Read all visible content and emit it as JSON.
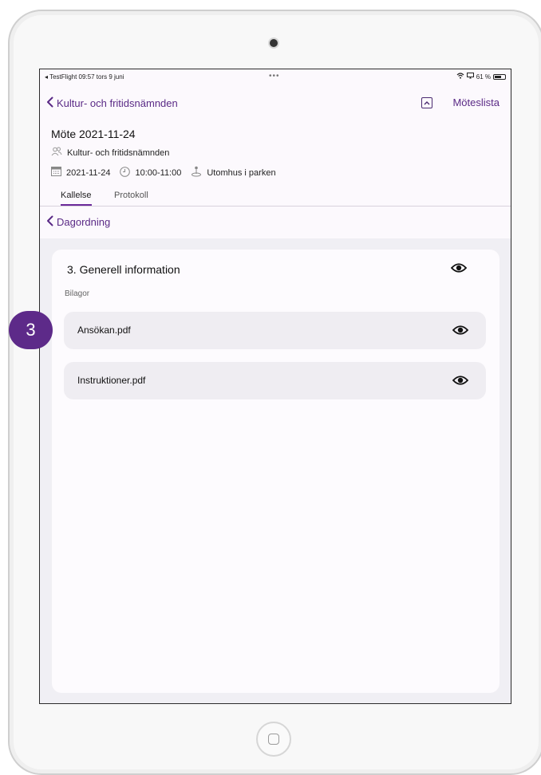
{
  "status_bar": {
    "left_text": "◂ TestFlight  09:57  tors 9 juni",
    "center_dots": "•••",
    "battery_text": "61 %"
  },
  "nav": {
    "back_label": "Kultur- och fritidsnämnden",
    "right_label": "Möteslista"
  },
  "meeting": {
    "title": "Möte 2021-11-24",
    "committee": "Kultur- och fritidsnämnden",
    "date": "2021-11-24",
    "time": "10:00-11:00",
    "location": "Utomhus i parken"
  },
  "tabs": [
    {
      "label": "Kallelse",
      "active": true
    },
    {
      "label": "Protokoll",
      "active": false
    }
  ],
  "subnav": {
    "back_label": "Dagordning"
  },
  "agenda_item": {
    "title": "3. Generell information",
    "attachments_label": "Bilagor",
    "attachments": [
      {
        "name": "Ansökan.pdf"
      },
      {
        "name": "Instruktioner.pdf"
      }
    ]
  },
  "step_badge": "3",
  "colors": {
    "accent": "#5a2a86",
    "badge": "#5d2a89",
    "card_bg": "#fdfbfe",
    "attachment_bg": "#efedf2"
  }
}
